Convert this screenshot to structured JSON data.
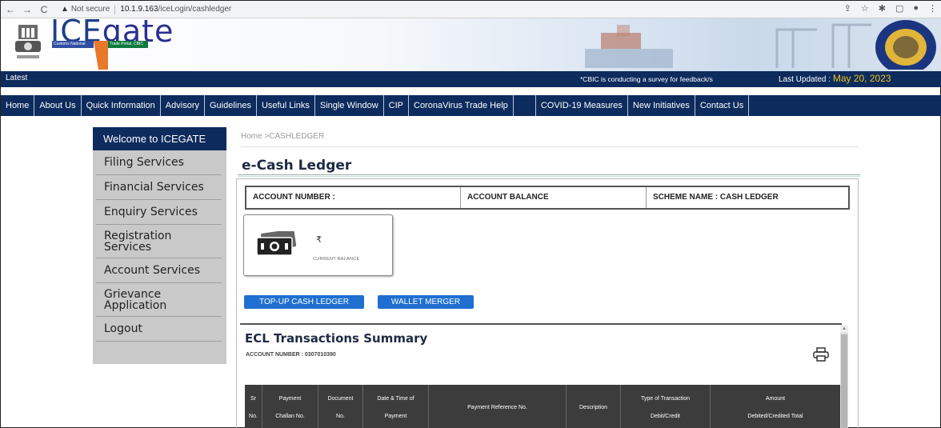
{
  "browser": {
    "security_label": "Not secure",
    "url_host": "10.1.9.163",
    "url_path": "/iceLogin/cashledger"
  },
  "banner": {
    "logo_ice": "ICE",
    "logo_gate": "gate",
    "logo_sub_left": "Customs National",
    "logo_sub_right": "Trade Portal, CBIC"
  },
  "latest": {
    "label": "Latest",
    "survey": "*CBIC is conducting a survey for feedback/s",
    "updated_label": "Last Updated :",
    "updated_date": "May 20, 2023"
  },
  "menu": {
    "items": [
      "Home",
      "About Us",
      "Quick Information",
      "Advisory",
      "Guidelines",
      "Useful Links",
      "Single Window",
      "CIP",
      "CoronaVirus Trade Help",
      "COVID-19 Measures",
      "New Initiatives",
      "Contact Us"
    ]
  },
  "sidebar": {
    "heading": "Welcome to ICEGATE",
    "items": [
      {
        "label": "Filing Services"
      },
      {
        "label": "Financial Services"
      },
      {
        "label": "Enquiry Services"
      },
      {
        "label": "Registration Services"
      },
      {
        "label": "Account Services"
      },
      {
        "label": "Grievance Application"
      },
      {
        "label": "Logout"
      }
    ]
  },
  "breadcrumb": "Home >CASHLEDGER",
  "page_title": "e-Cash Ledger",
  "account": {
    "number_label": "ACCOUNT NUMBER :",
    "balance_label": "ACCOUNT BALANCE",
    "scheme_label": "SCHEME NAME : CASH LEDGER"
  },
  "balance_card": {
    "currency": "₹",
    "caption": "CURRENT BALANCE"
  },
  "buttons": {
    "topup": "TOP-UP CASH LEDGER",
    "merge": "WALLET MERGER"
  },
  "summary": {
    "title": "ECL Transactions Summary",
    "account_line": "ACCOUNT NUMBER : 0307010390"
  },
  "table": {
    "columns": [
      {
        "l1": "Sr",
        "l2": "No."
      },
      {
        "l1": "Payment",
        "l2": "Challan No."
      },
      {
        "l1": "Document",
        "l2": "No."
      },
      {
        "l1": "Date & Time of",
        "l2": "Payment"
      },
      {
        "l1": "Payment Reference No.",
        "l2": ""
      },
      {
        "l1": "Description",
        "l2": ""
      },
      {
        "l1": "Type of Transaction",
        "l2": "Debit/Credit"
      },
      {
        "l1": "Amount",
        "l2": "Debited/Credited Total"
      }
    ]
  },
  "colors": {
    "navy": "#0d2b5c",
    "button_blue": "#1f6fd1",
    "highlight_yellow": "#f0c020"
  }
}
